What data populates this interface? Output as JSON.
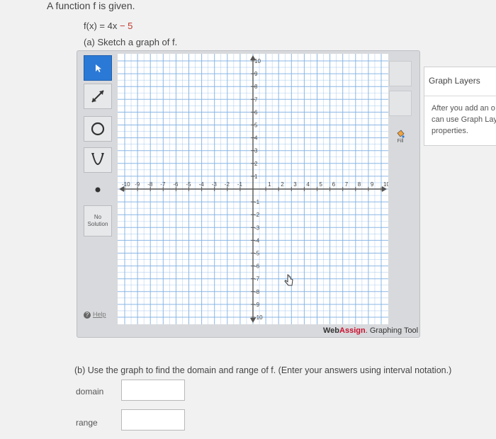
{
  "problem": {
    "prompt": "A function f is given.",
    "function_lhs": "f(x) = 4x",
    "function_rhs": " − 5",
    "part_a": "(a) Sketch a graph of f.",
    "part_b": "(b) Use the graph to find the domain and range of f. (Enter your answers using interval notation.)"
  },
  "toolbar": {
    "tools": [
      "pointer-tool",
      "line-tool",
      "circle-tool",
      "parabola-tool",
      "point-tool"
    ],
    "no_solution_line1": "No",
    "no_solution_line2": "Solution",
    "help_label": "Help"
  },
  "graph": {
    "x_ticks": [
      "-10",
      "-9",
      "-8",
      "-7",
      "-6",
      "-5",
      "-4",
      "-3",
      "-2",
      "-1",
      "1",
      "2",
      "3",
      "4",
      "5",
      "6",
      "7",
      "8",
      "9",
      "10"
    ],
    "y_ticks_pos": [
      "10",
      "9",
      "8",
      "7",
      "6",
      "5",
      "4",
      "3",
      "2",
      "1"
    ],
    "y_ticks_neg": [
      "-1",
      "-2",
      "-3",
      "-4",
      "-5",
      "-6",
      "-7",
      "-8",
      "-9",
      "-10"
    ],
    "xlim": [
      -10,
      10
    ],
    "ylim": [
      -10,
      10
    ]
  },
  "right_panel": {
    "fill_label": "Fill"
  },
  "branding": {
    "part1": "Web",
    "part2": "Assign",
    "suffix": ". Graphing Tool"
  },
  "layers_panel": {
    "title": "Graph Layers",
    "line1": "After you add an o",
    "line2": "can use Graph Lay",
    "line3": "properties."
  },
  "answers": {
    "domain_label": "domain",
    "domain_value": "",
    "range_label": "range",
    "range_value": ""
  },
  "colors": {
    "grid_line": "#7fb0e3",
    "axis": "#555555",
    "selected_tool": "#2b79d6",
    "function_highlight": "#c0392b"
  }
}
